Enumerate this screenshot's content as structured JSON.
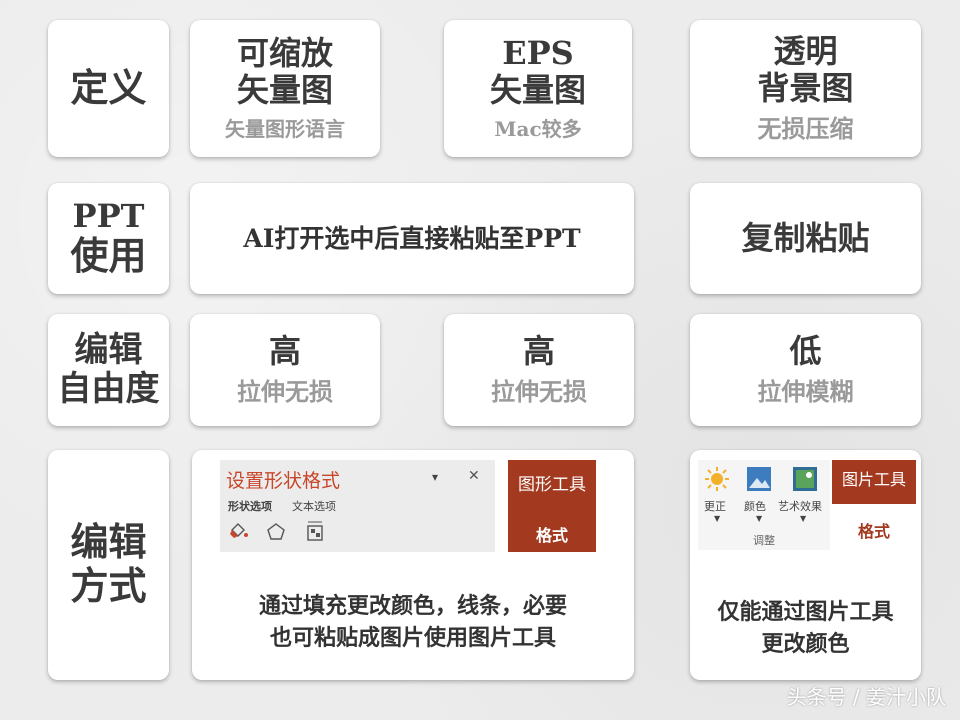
{
  "rows": {
    "definition": {
      "label": "定义",
      "cells": [
        {
          "title": [
            "可缩放",
            "矢量图"
          ],
          "sub": "矢量图形语言"
        },
        {
          "title": [
            "EPS",
            "矢量图"
          ],
          "sub": "Mac较多"
        },
        {
          "title": [
            "透明",
            "背景图"
          ],
          "sub": "无损压缩"
        }
      ]
    },
    "ppt": {
      "label": [
        "PPT",
        "使用"
      ],
      "cells": [
        {
          "text": "AI打开选中后直接粘贴至PPT"
        },
        {
          "text": "复制粘贴"
        }
      ]
    },
    "edit_freedom": {
      "label": [
        "编辑",
        "自由度"
      ],
      "cells": [
        {
          "title": "高",
          "sub": "拉伸无损"
        },
        {
          "title": "高",
          "sub": "拉伸无损"
        },
        {
          "title": "低",
          "sub": "拉伸模糊"
        }
      ]
    },
    "edit_method": {
      "label": [
        "编辑",
        "方式"
      ],
      "shape_pane": {
        "title": "设置形状格式",
        "tab_active": "形状选项",
        "tab_other": "文本选项",
        "dropdown_glyph": "▾",
        "close_glyph": "✕"
      },
      "shape_tool": {
        "group": "图形工具",
        "tab": "格式"
      },
      "picture_ribbon": {
        "buttons": [
          "更正",
          "颜色",
          "艺术效果"
        ],
        "group": "调整"
      },
      "picture_tool": {
        "group": "图片工具",
        "tab": "格式"
      },
      "cells": [
        {
          "text": [
            "通过填充更改颜色，线条，必要",
            "也可粘贴成图片使用图片工具"
          ]
        },
        {
          "text": [
            "仅能通过图片工具",
            "更改颜色"
          ]
        }
      ]
    }
  },
  "watermark": "头条号 / 姜汁小队",
  "colors": {
    "accent_red": "#a33a1f",
    "title_red": "#c8462a",
    "text_dark": "#3a3a3a",
    "text_grey": "#9a9a9a"
  }
}
